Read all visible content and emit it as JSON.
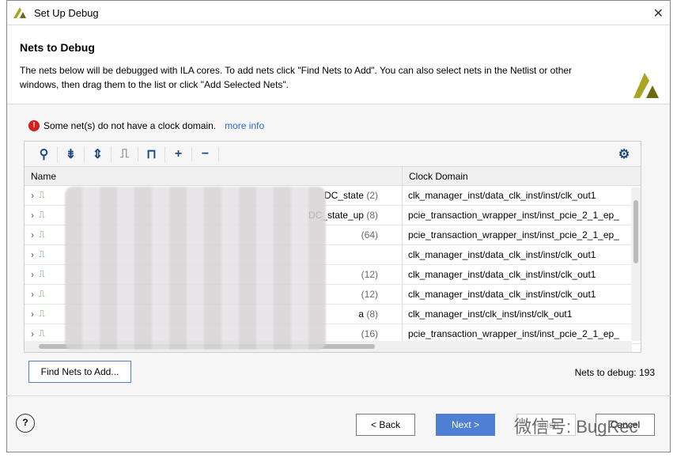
{
  "window": {
    "title": "Set Up Debug",
    "close_icon": "close-icon"
  },
  "header": {
    "title": "Nets to Debug",
    "description": "The nets below will be debugged with ILA cores. To add nets click \"Find Nets to Add\". You can also select nets in the Netlist or other windows, then drag them to the list or click \"Add Selected Nets\"."
  },
  "warning": {
    "text": "Some net(s) do not have a clock domain.",
    "link": "more info"
  },
  "toolbar": [
    "search-icon",
    "collapse-all-icon",
    "expand-all-icon",
    "probe-type-icon",
    "clock-icon",
    "add-icon",
    "remove-icon",
    "gear-icon"
  ],
  "table": {
    "columns": [
      "Name",
      "Clock Domain"
    ],
    "rows": [
      {
        "name": "DC_state",
        "count": "(2)",
        "clock": "clk_manager_inst/data_clk_inst/inst/clk_out1"
      },
      {
        "name": "DC_state_up",
        "count": "(8)",
        "clock": "pcie_transaction_wrapper_inst/inst_pcie_2_1_ep_"
      },
      {
        "name": "",
        "count": "(64)",
        "clock": "pcie_transaction_wrapper_inst/inst_pcie_2_1_ep_"
      },
      {
        "name": "",
        "count": "",
        "clock": "clk_manager_inst/data_clk_inst/inst/clk_out1"
      },
      {
        "name": "",
        "count": "(12)",
        "clock": "clk_manager_inst/data_clk_inst/inst/clk_out1"
      },
      {
        "name": "",
        "count": "(12)",
        "clock": "clk_manager_inst/data_clk_inst/inst/clk_out1"
      },
      {
        "name": "a",
        "count": "(8)",
        "clock": "clk_manager_inst/clk_inst/inst/clk_out1"
      },
      {
        "name": "",
        "count": "(16)",
        "clock": "pcie_transaction_wrapper_inst/inst_pcie_2_1_ep_"
      }
    ]
  },
  "find_button": "Find Nets to Add...",
  "nets_count": "Nets to debug: 193",
  "footer": {
    "back": "< Back",
    "next": "Next >",
    "finish": "Finish",
    "cancel": "Cancel"
  },
  "watermark": "微信号: BugRec",
  "colors": {
    "accent": "#4f7fd2",
    "warning": "#d42020",
    "link": "#2a6bd0"
  }
}
